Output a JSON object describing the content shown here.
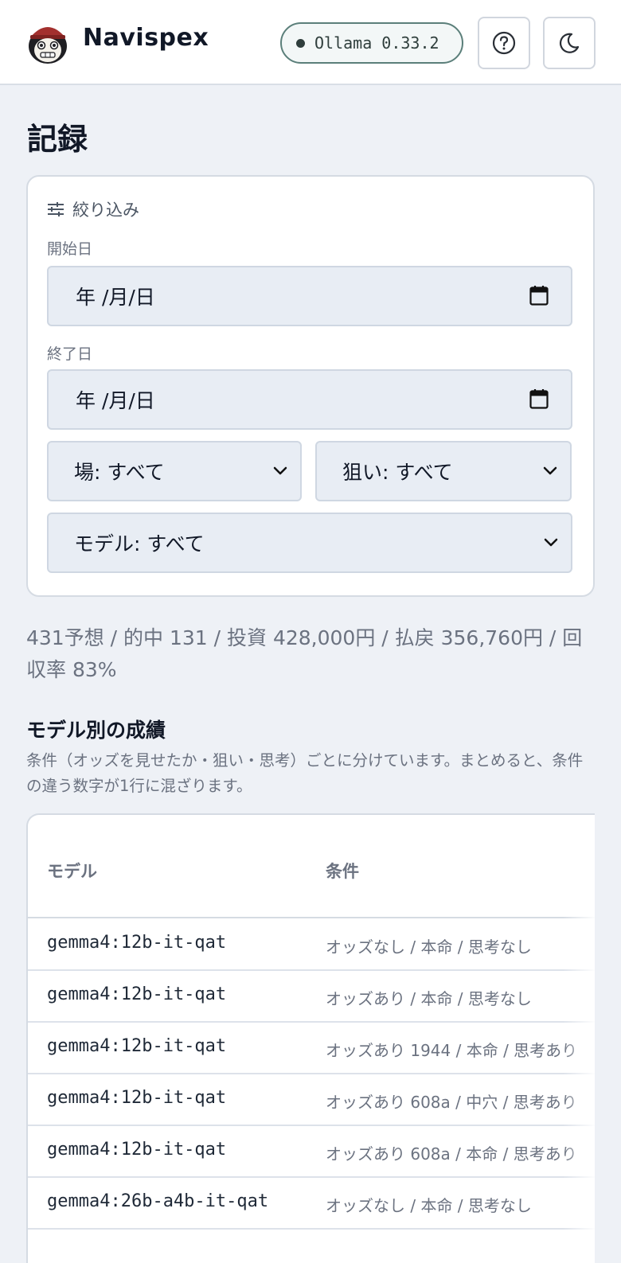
{
  "header": {
    "brand": "Navispex",
    "status": "Ollama 0.33.2"
  },
  "page": {
    "title": "記録"
  },
  "filters": {
    "heading": "絞り込み",
    "start_label": "開始日",
    "start_value": "年 /月/日",
    "end_label": "終了日",
    "end_value": "年 /月/日",
    "venue": "場: すべて",
    "aim": "狙い: すべて",
    "model": "モデル: すべて"
  },
  "summary": "431予想 / 的中 131 / 投資 428,000円 / 払戻 356,760円 / 回収率 83%",
  "model_section": {
    "title": "モデル別の成績",
    "description": "条件（オッズを見せたか・狙い・思考）ごとに分けています。まとめると、条件の違う数字が1行に混ざります。"
  },
  "table": {
    "columns": [
      "モデル",
      "条件"
    ],
    "rows": [
      {
        "model": "gemma4:12b-it-qat",
        "condition": "オッズなし / 本命 / 思考なし"
      },
      {
        "model": "gemma4:12b-it-qat",
        "condition": "オッズあり / 本命 / 思考なし"
      },
      {
        "model": "gemma4:12b-it-qat",
        "condition": "オッズあり 1944 / 本命 / 思考あり"
      },
      {
        "model": "gemma4:12b-it-qat",
        "condition": "オッズあり 608a / 中穴 / 思考あり"
      },
      {
        "model": "gemma4:12b-it-qat",
        "condition": "オッズあり 608a / 本命 / 思考あり"
      },
      {
        "model": "gemma4:26b-a4b-it-qat",
        "condition": "オッズなし / 本命 / 思考なし"
      }
    ]
  }
}
